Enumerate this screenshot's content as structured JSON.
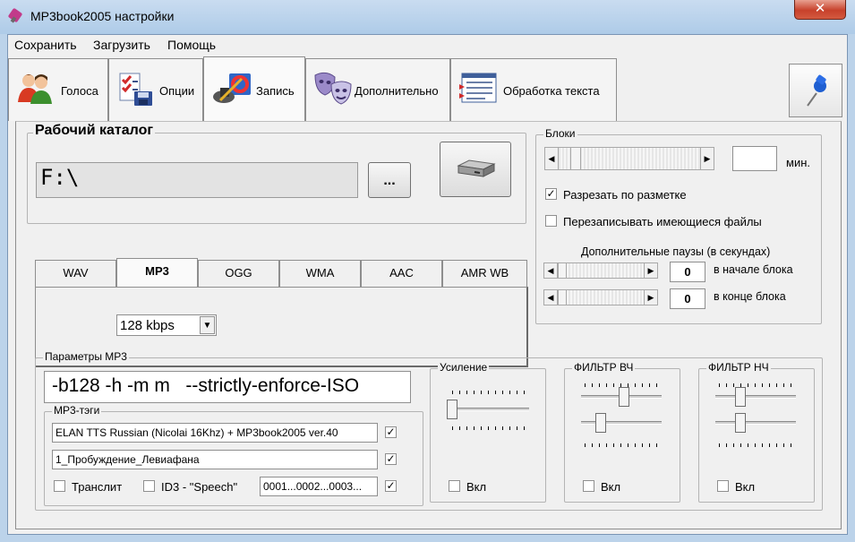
{
  "window": {
    "title": "MP3book2005 настройки",
    "close_glyph": "✕"
  },
  "menu": [
    "Сохранить",
    "Загрузить",
    "Помощь"
  ],
  "tabs": [
    {
      "label": "Голоса",
      "icon": "people-icon"
    },
    {
      "label": "Опции",
      "icon": "checklist-icon"
    },
    {
      "label": "Запись",
      "icon": "record-icon"
    },
    {
      "label": "Дополнительно",
      "icon": "masks-icon"
    },
    {
      "label": "Обработка текста",
      "icon": "text-processing-icon"
    }
  ],
  "workdir": {
    "title": "Рабочий каталог",
    "path": "F:\\",
    "browse_label": "...",
    "drive_icon": "drive-icon"
  },
  "formats": {
    "tabs": [
      "WAV",
      "MP3",
      "OGG",
      "WMA",
      "AAC",
      "AMR WB"
    ],
    "active": "MP3",
    "bitrate": "128 kbps"
  },
  "blocks": {
    "title": "Блоки",
    "minutes_value": "",
    "minutes_unit": "мин.",
    "cut_by_markup": {
      "label": "Разрезать по разметке",
      "checked": true
    },
    "overwrite_files": {
      "label": "Перезаписывать имеющиеся файлы",
      "checked": false
    },
    "pauses_title": "Дополнительные паузы (в секундах)",
    "pause_start": {
      "value": "0",
      "label": "в начале блока"
    },
    "pause_end": {
      "value": "0",
      "label": "в конце блока"
    }
  },
  "mp3params": {
    "title": "Параметры MP3",
    "command_line": "-b128 -h -m m   --strictly-enforce-ISO",
    "tags_title": "MP3-тэги",
    "tag1": {
      "value": "ELAN TTS Russian (Nicolai 16Khz) + MP3book2005 ver.40",
      "checked": true
    },
    "tag2": {
      "value": "1_Пробуждение_Левиафана",
      "checked": true
    },
    "translit": {
      "label": "Транслит",
      "checked": false
    },
    "id3_speech": {
      "label": "ID3 - \"Speech\"",
      "checked": false
    },
    "track_number": {
      "value": "0001...0002...0003...",
      "checked": true
    },
    "gain": {
      "title": "Усиление",
      "on_label": "Вкл",
      "on": false
    },
    "hpf": {
      "title": "ФИЛЬТР ВЧ",
      "on_label": "Вкл",
      "on": false
    },
    "lpf": {
      "title": "ФИЛЬТР НЧ",
      "on_label": "Вкл",
      "on": false
    }
  },
  "colors": {
    "titlebar": "#bcd3ea",
    "close": "#c7412b",
    "window_bg": "#f0f0f0"
  }
}
